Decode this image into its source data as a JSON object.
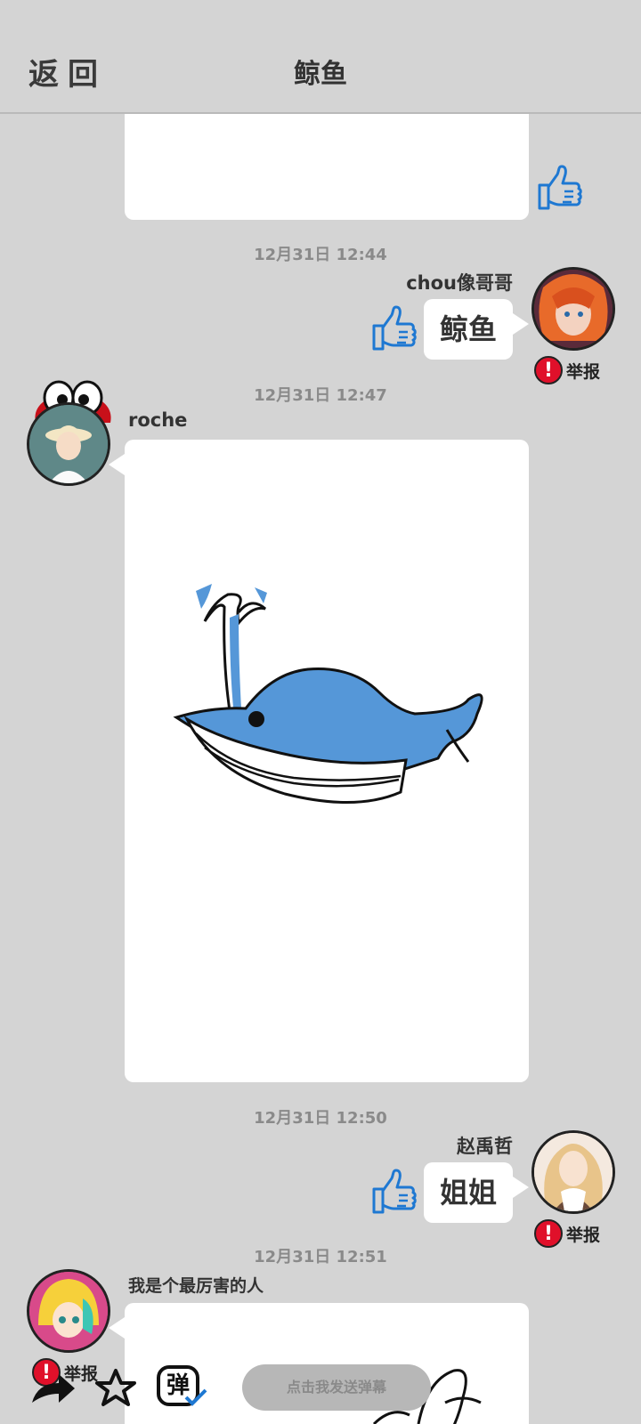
{
  "header": {
    "back_label": "返回",
    "title": "鲸鱼"
  },
  "messages": [
    {
      "timestamp": "12月31日  12:44",
      "sender": "chou像哥哥",
      "text": "鲸鱼",
      "report_label": "举报"
    },
    {
      "timestamp": "12月31日  12:47",
      "sender": "roche"
    },
    {
      "timestamp": "12月31日  12:50",
      "sender": "赵禹哲",
      "text": "姐姐",
      "report_label": "举报"
    },
    {
      "timestamp": "12月31日  12:51",
      "sender": "我是个最厉害的人",
      "report_label": "举报"
    }
  ],
  "bottom_bar": {
    "danmu_placeholder": "点击我发送弹幕",
    "danmu_toggle_label": "弹"
  },
  "colors": {
    "background": "#d4d4d4",
    "bubble": "#ffffff",
    "thumb_blue": "#1e78d2",
    "report_red": "#e0102a",
    "whale_blue": "#5597d8"
  },
  "icons": [
    "thumbs-up-icon",
    "exclamation-icon",
    "share-icon",
    "star-icon",
    "danmu-toggle-icon"
  ]
}
